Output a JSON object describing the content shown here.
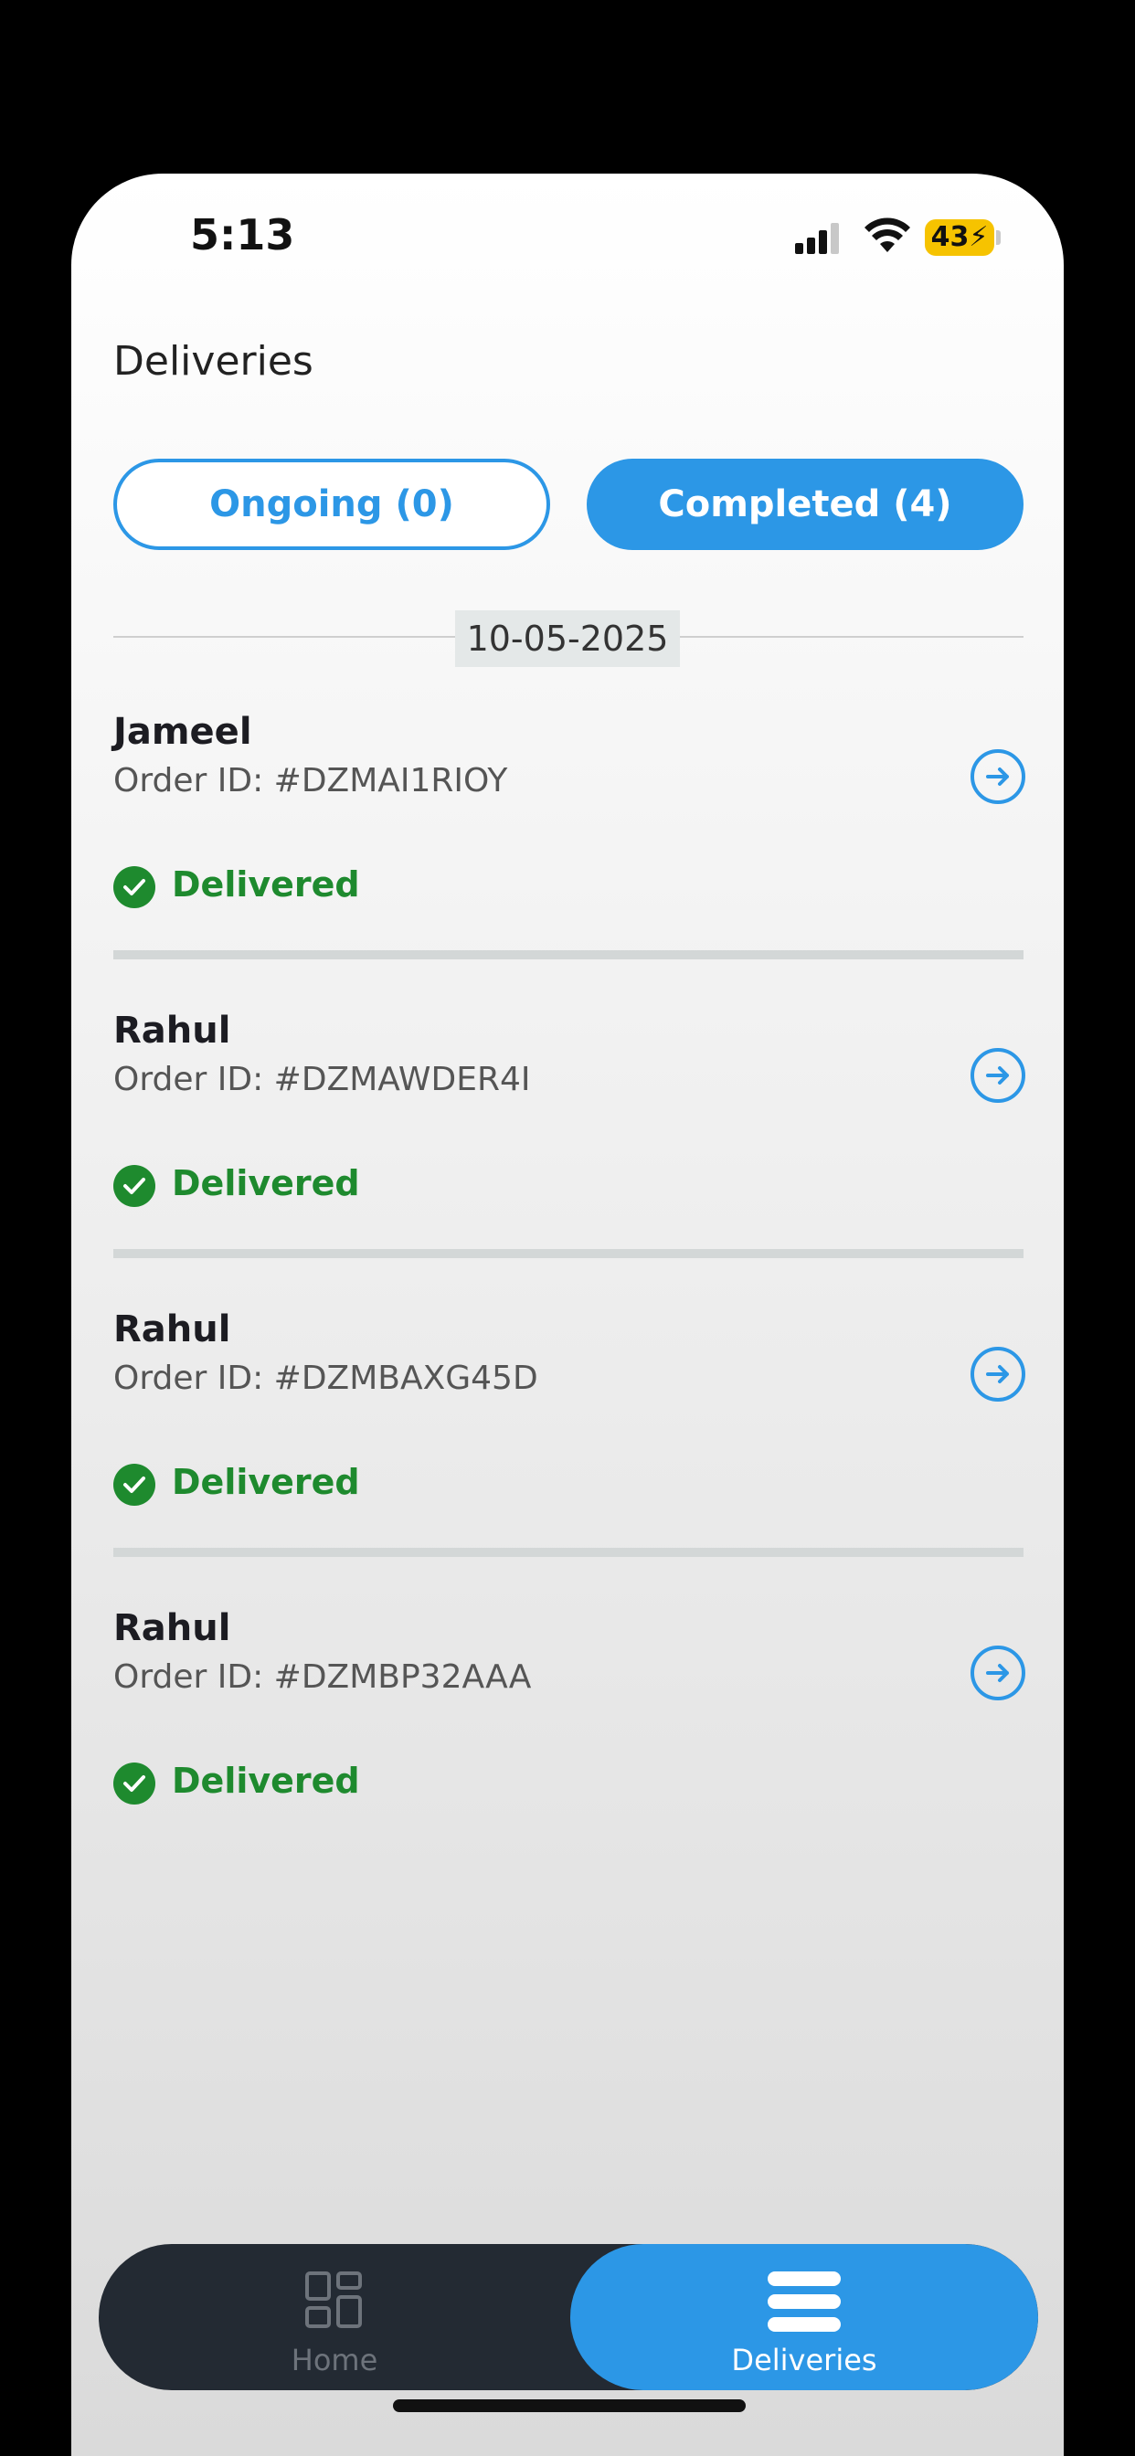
{
  "status_bar": {
    "time": "5:13",
    "battery": "43⚡",
    "icons": [
      "signal-icon",
      "wifi-icon",
      "battery-icon"
    ]
  },
  "header": {
    "title": "Deliveries"
  },
  "tabs": {
    "ongoing": "Ongoing (0)",
    "completed": "Completed (4)"
  },
  "date_group": "10-05-2025",
  "orders": [
    {
      "name": "Jameel",
      "order_id": "Order ID: #DZMAI1RIOY",
      "status": "Delivered"
    },
    {
      "name": "Rahul",
      "order_id": "Order ID: #DZMAWDER4I",
      "status": "Delivered"
    },
    {
      "name": "Rahul",
      "order_id": "Order ID: #DZMBAXG45D",
      "status": "Delivered"
    },
    {
      "name": "Rahul",
      "order_id": "Order ID: #DZMBP32AAA",
      "status": "Delivered"
    }
  ],
  "bottom_nav": {
    "home_label": "Home",
    "deliveries_label": "Deliveries",
    "active": "Deliveries"
  },
  "colors": {
    "accent": "#2c97e6",
    "delivered_green": "#1e8a2e",
    "nav_dark": "#232a33",
    "battery_yellow": "#f6c300"
  }
}
